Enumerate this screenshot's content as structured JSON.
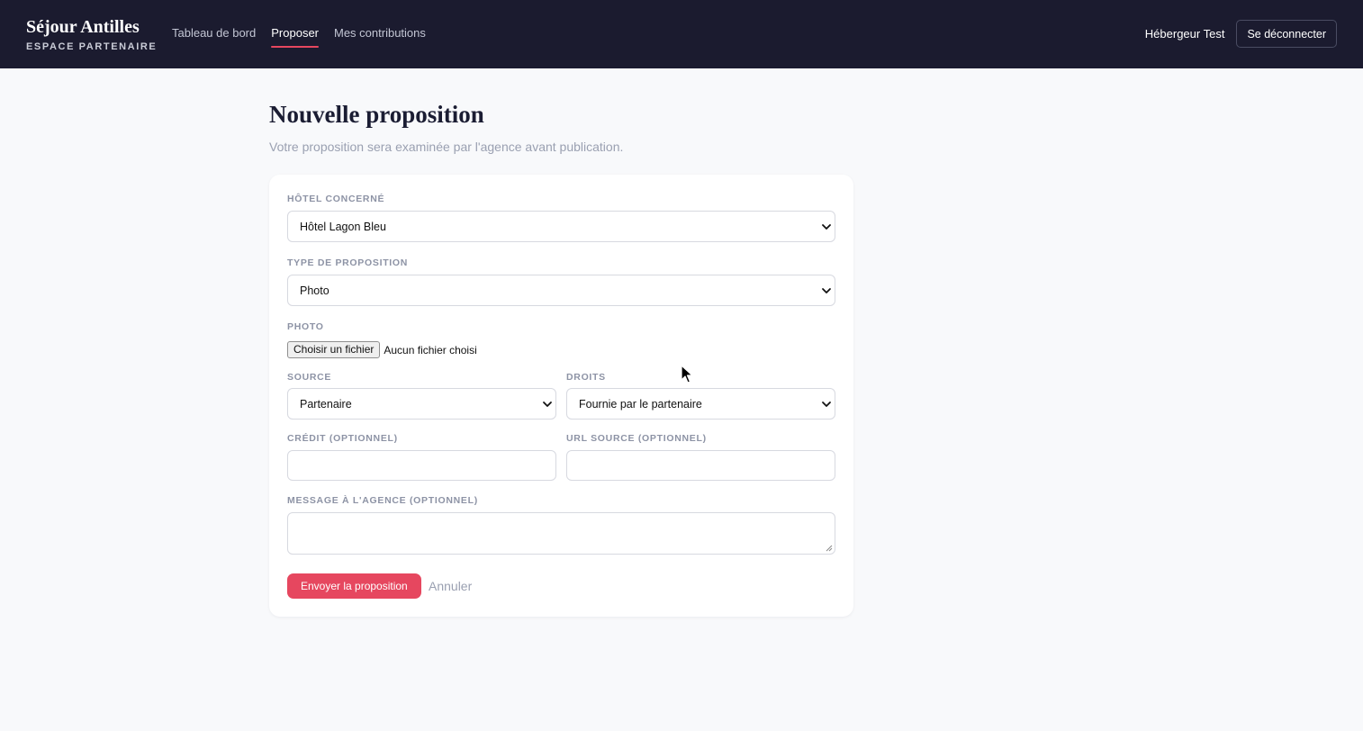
{
  "header": {
    "brand_name": "Séjour Antilles",
    "brand_subtitle": "ESPACE PARTENAIRE",
    "nav": [
      {
        "label": "Tableau de bord",
        "active": false
      },
      {
        "label": "Proposer",
        "active": true
      },
      {
        "label": "Mes contributions",
        "active": false
      }
    ],
    "user_name": "Hébergeur Test",
    "logout_label": "Se déconnecter"
  },
  "page": {
    "title": "Nouvelle proposition",
    "subtitle": "Votre proposition sera examinée par l'agence avant publication."
  },
  "form": {
    "hotel": {
      "label": "HÔTEL CONCERNÉ",
      "value": "Hôtel Lagon Bleu"
    },
    "type": {
      "label": "TYPE DE PROPOSITION",
      "value": "Photo"
    },
    "photo": {
      "label": "PHOTO",
      "button_label": "Choisir un fichier",
      "status": "Aucun fichier choisi"
    },
    "source": {
      "label": "SOURCE",
      "value": "Partenaire"
    },
    "rights": {
      "label": "DROITS",
      "value": "Fournie par le partenaire"
    },
    "credit": {
      "label": "CRÉDIT (OPTIONNEL)",
      "value": ""
    },
    "source_url": {
      "label": "URL SOURCE (OPTIONNEL)",
      "value": ""
    },
    "message": {
      "label": "MESSAGE À L'AGENCE (OPTIONNEL)",
      "value": ""
    },
    "submit_label": "Envoyer la proposition",
    "cancel_label": "Annuler"
  },
  "colors": {
    "header_bg": "#1b1b2f",
    "accent": "#e6475f",
    "page_bg": "#f8f9fb",
    "muted_text": "#9aa0b1"
  }
}
